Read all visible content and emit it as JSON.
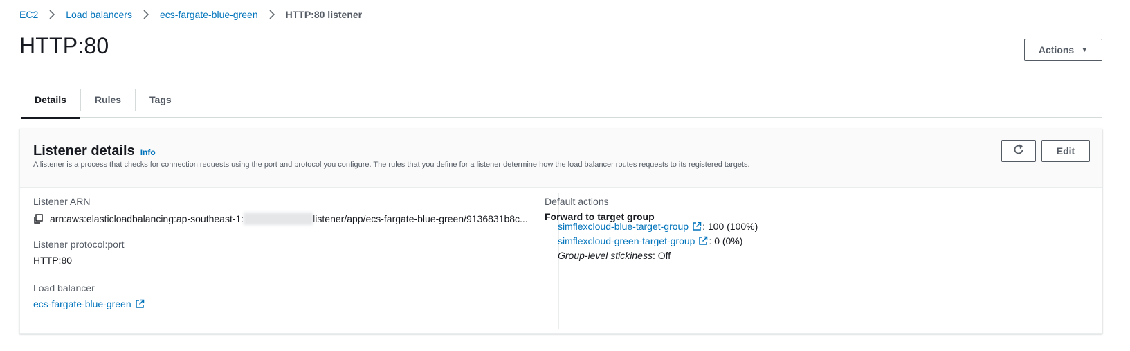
{
  "breadcrumb": {
    "items": [
      "EC2",
      "Load balancers",
      "ecs-fargate-blue-green"
    ],
    "current": "HTTP:80 listener"
  },
  "page": {
    "title": "HTTP:80"
  },
  "header": {
    "actions_label": "Actions"
  },
  "tabs": [
    {
      "label": "Details",
      "active": true
    },
    {
      "label": "Rules",
      "active": false
    },
    {
      "label": "Tags",
      "active": false
    }
  ],
  "panel": {
    "title": "Listener details",
    "info": "Info",
    "description": "A listener is a process that checks for connection requests using the port and protocol you configure. The rules that you define for a listener determine how the load balancer routes requests to its registered targets.",
    "edit_label": "Edit"
  },
  "details": {
    "arn_label": "Listener ARN",
    "arn_prefix": "arn:aws:elasticloadbalancing:ap-southeast-1:",
    "arn_suffix": "listener/app/ecs-fargate-blue-green/9136831b8c...",
    "protocol_label": "Listener protocol:port",
    "protocol_value": "HTTP:80",
    "lb_label": "Load balancer",
    "lb_value": "ecs-fargate-blue-green"
  },
  "default_actions": {
    "label": "Default actions",
    "heading": "Forward to target group",
    "target_groups": [
      {
        "name": "simflexcloud-blue-target-group",
        "weight": ": 100 (100%)"
      },
      {
        "name": "simflexcloud-green-target-group",
        "weight": ": 0 (0%)"
      }
    ],
    "stickiness_label": "Group-level stickiness",
    "stickiness_value": ": Off"
  },
  "colors": {
    "link": "#0073bb",
    "text": "#16191f",
    "muted": "#545b64"
  },
  "icons": [
    "chevron-right-icon",
    "caret-down-icon",
    "refresh-icon",
    "copy-icon",
    "external-link-icon"
  ]
}
